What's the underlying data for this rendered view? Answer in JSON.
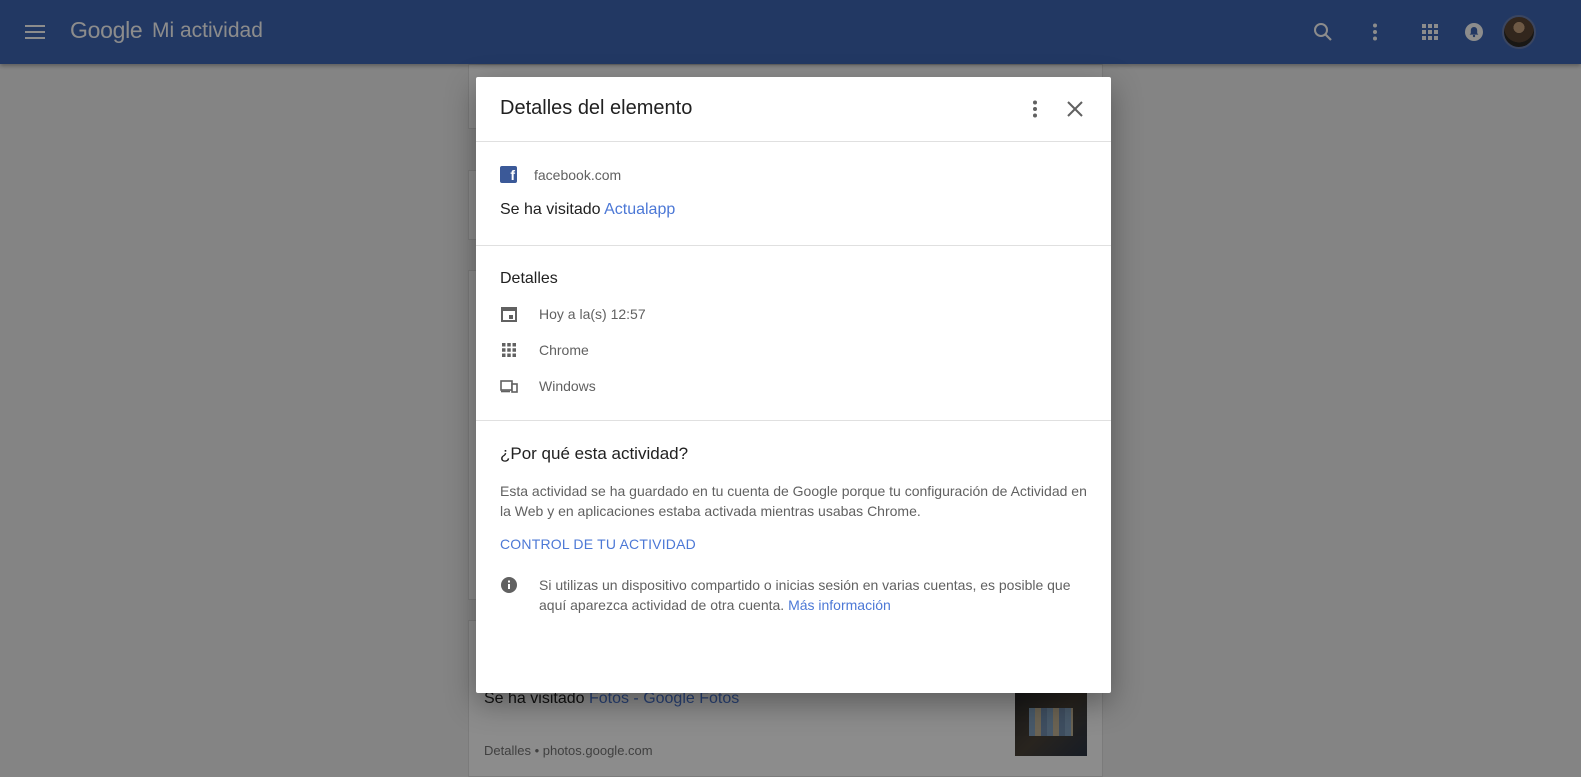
{
  "header": {
    "logo": "Google",
    "title": "Mi actividad"
  },
  "background": {
    "item_prefix": "Se ha visitado ",
    "item_link": "Fotos - Google Fotos",
    "item_meta": "Detalles • photos.google.com"
  },
  "dialog": {
    "title": "Detalles del elemento",
    "site": "facebook.com",
    "visited_prefix": "Se ha visitado ",
    "visited_link": "Actualapp",
    "details_heading": "Detalles",
    "details": [
      {
        "icon": "calendar-icon",
        "text": "Hoy a la(s) 12:57"
      },
      {
        "icon": "apps-icon",
        "text": "Chrome"
      },
      {
        "icon": "devices-icon",
        "text": "Windows"
      }
    ],
    "why_heading": "¿Por qué esta actividad?",
    "why_text": "Esta actividad se ha guardado en tu cuenta de Google porque tu configuración de Actividad en la Web y en aplicaciones estaba activada mientras usabas Chrome.",
    "control_link": "CONTROL DE TU ACTIVIDAD",
    "info_text": "Si utilizas un dispositivo compartido o inicias sesión en varias cuentas, es posible que aquí aparezca actividad de otra cuenta. ",
    "info_link": "Más información"
  },
  "colors": {
    "header": "#3f66b4",
    "link": "#4c78d6",
    "facebook": "#3b5998"
  }
}
